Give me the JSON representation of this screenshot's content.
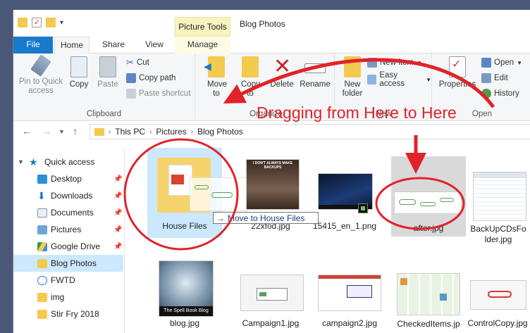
{
  "window": {
    "title": "Blog Photos",
    "contextual_tab": "Picture Tools"
  },
  "tabs": {
    "file": "File",
    "home": "Home",
    "share": "Share",
    "view": "View",
    "manage": "Manage"
  },
  "ribbon": {
    "clipboard": {
      "pin": "Pin to Quick access",
      "copy": "Copy",
      "paste": "Paste",
      "cut": "Cut",
      "copy_path": "Copy path",
      "paste_shortcut": "Paste shortcut",
      "label": "Clipboard"
    },
    "organize": {
      "move_to": "Move to",
      "copy_to": "Copy to",
      "delete": "Delete",
      "rename": "Rename",
      "label": "Organize"
    },
    "new": {
      "new_folder": "New folder",
      "new_item": "New item",
      "easy_access": "Easy access",
      "label": "New"
    },
    "open": {
      "properties": "Properties",
      "open": "Open",
      "edit": "Edit",
      "history": "History",
      "label": "Open"
    }
  },
  "address": {
    "crumbs": [
      "This PC",
      "Pictures",
      "Blog Photos"
    ]
  },
  "nav": {
    "quick_access": "Quick access",
    "items": [
      "Desktop",
      "Downloads",
      "Documents",
      "Pictures",
      "Google Drive",
      "Blog Photos",
      "FWTD",
      "img",
      "Stir Fry 2018"
    ]
  },
  "files": {
    "row1": [
      "House Files",
      "22xfod.jpg",
      "15415_en_1.png",
      "after.jpg",
      "BackUpCDsFolder.jpg"
    ],
    "row2": [
      "blog.jpg",
      "Campaign1.jpg",
      "campaign2.jpg",
      "CheckedItems.jpg",
      "ControlCopy.jpg"
    ],
    "thumb_texts": {
      "meme_top": "I DON'T ALWAYS MAKE BACKUPS",
      "blog_caption": "The Spell Book Blog"
    }
  },
  "drag": {
    "tooltip": "Move to House Files"
  },
  "annotation": {
    "text": "Dragging from Here to Here"
  },
  "colors": {
    "accent": "#1979ca",
    "annotation_red": "#e0222a",
    "selection": "#cce8ff",
    "folder": "#f3c94e"
  }
}
